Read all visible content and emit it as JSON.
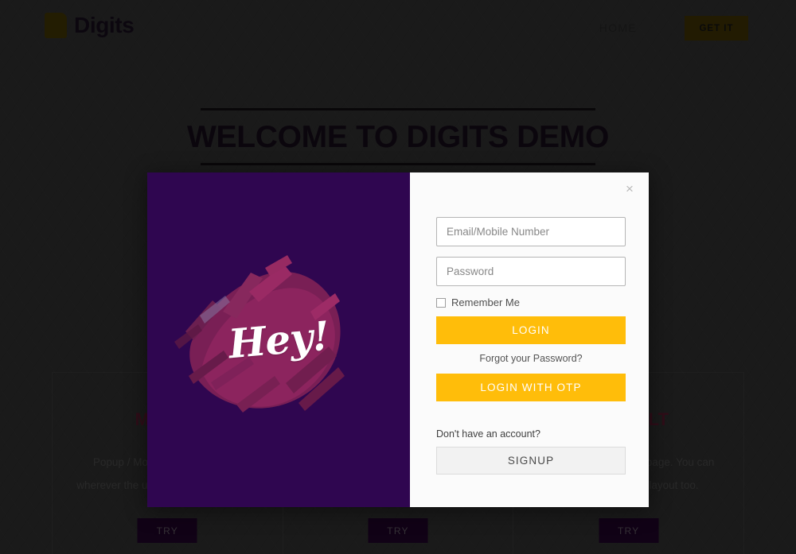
{
  "header": {
    "logo_text": "Digits",
    "nav_home": "HOME",
    "get_it_label": "GET IT",
    "logo_color": "#4a3d05",
    "button_color": "#473a05"
  },
  "hero": {
    "title": "WELCOME TO DIGITS DEMO"
  },
  "cards": [
    {
      "title": "MODAL",
      "desc": "Popup / Modal triggers anytime wherever the user is for login / signup.",
      "try_label": "TRY"
    },
    {
      "title": "",
      "desc": "",
      "try_label": "TRY"
    },
    {
      "title": "DEFAULT",
      "desc": "Default login / signup page. You can have your theme's layout too.",
      "try_label": "TRY"
    }
  ],
  "modal": {
    "close_icon": "×",
    "visual": {
      "greeting": "Hey!",
      "background_color": "#2f0650",
      "stroke_color": "#8e2461"
    },
    "email_placeholder": "Email/Mobile Number",
    "email_value": "",
    "password_placeholder": "Password",
    "password_value": "",
    "remember_label": "Remember Me",
    "login_label": "LOGIN",
    "forgot_label": "Forgot your Password?",
    "login_otp_label": "LOGIN WITH OTP",
    "no_account_text": "Don't have an account?",
    "signup_label": "SIGNUP",
    "accent_color": "#ffbd0a"
  }
}
